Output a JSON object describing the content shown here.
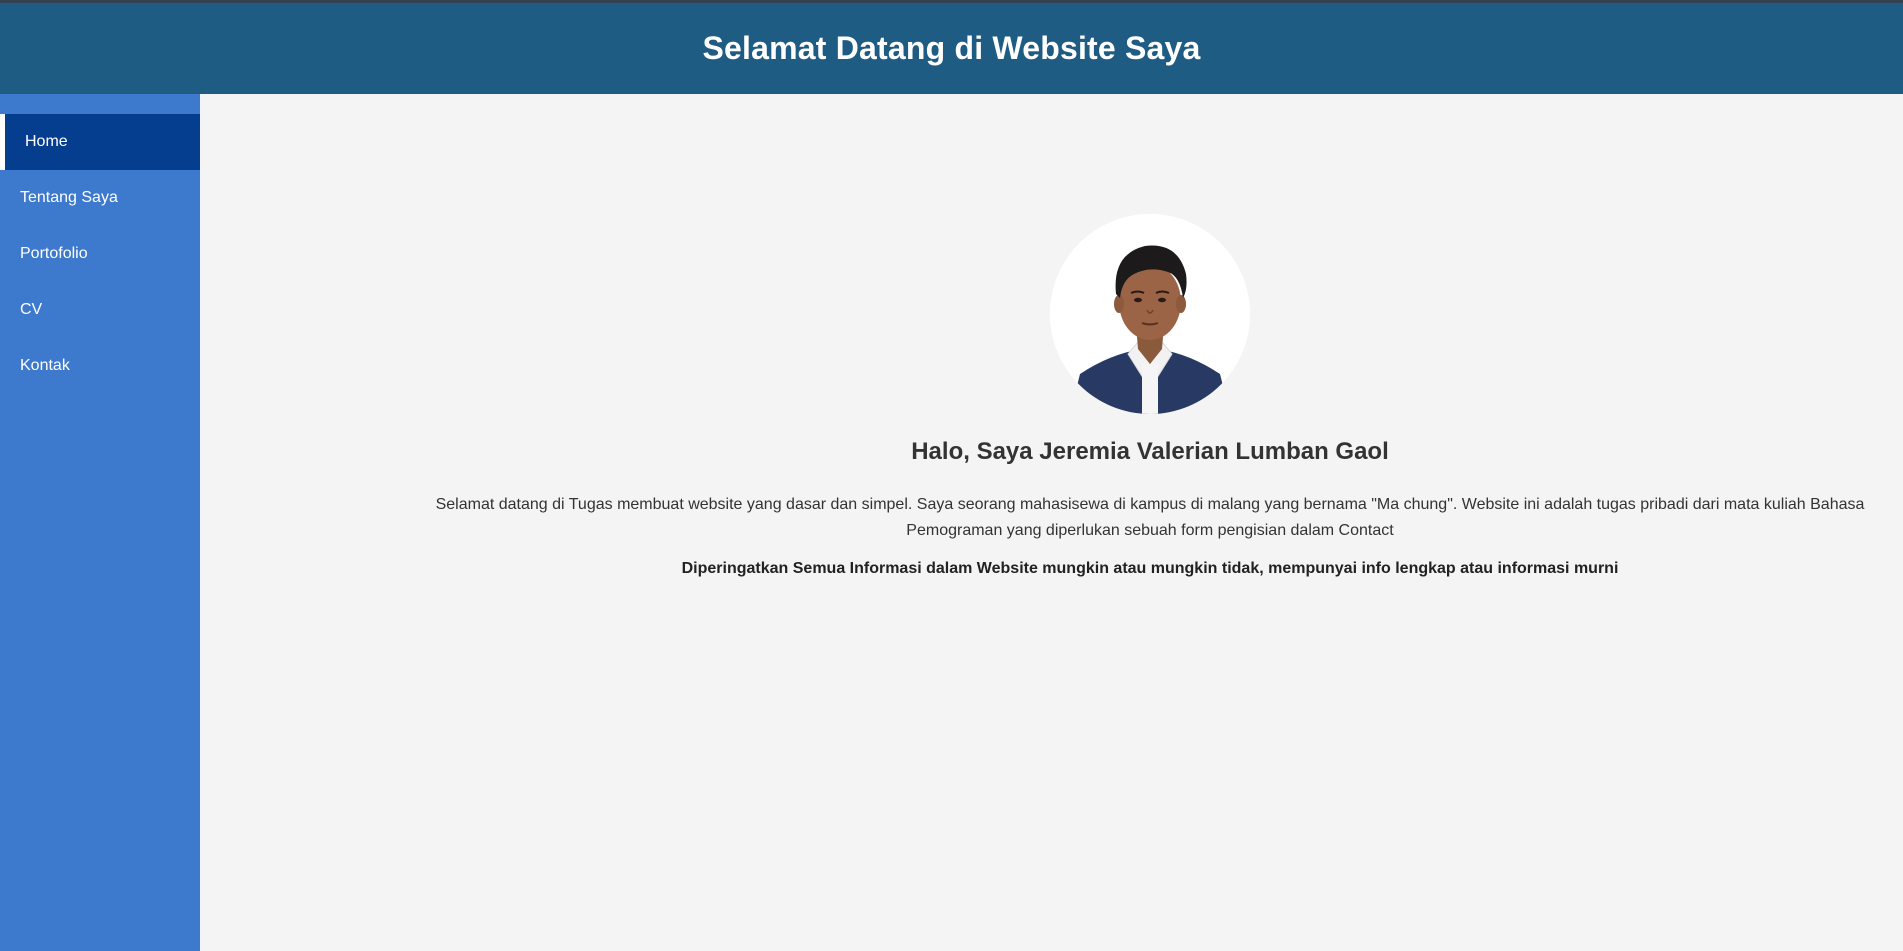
{
  "header": {
    "title": "Selamat Datang di Website Saya"
  },
  "sidebar": {
    "items": [
      {
        "label": "Home",
        "active": true
      },
      {
        "label": "Tentang Saya",
        "active": false
      },
      {
        "label": "Portofolio",
        "active": false
      },
      {
        "label": "CV",
        "active": false
      },
      {
        "label": "Kontak",
        "active": false
      }
    ]
  },
  "main": {
    "greeting": "Halo, Saya Jeremia Valerian Lumban Gaol",
    "intro": "Selamat datang di Tugas membuat website yang dasar dan simpel. Saya seorang mahasisewa di kampus di malang yang bernama \"Ma chung\". Website ini adalah tugas pribadi dari mata kuliah Bahasa Pemograman yang diperlukan sebuah form pengisian dalam Contact",
    "warning": "Diperingatkan Semua Informasi dalam Website mungkin atau mungkin tidak, mempunyai info lengkap atau informasi murni"
  },
  "colors": {
    "header_bg": "#1f5c83",
    "sidebar_bg": "#3d79cc",
    "sidebar_active_bg": "#063e8f",
    "page_bg": "#f4f4f4"
  }
}
